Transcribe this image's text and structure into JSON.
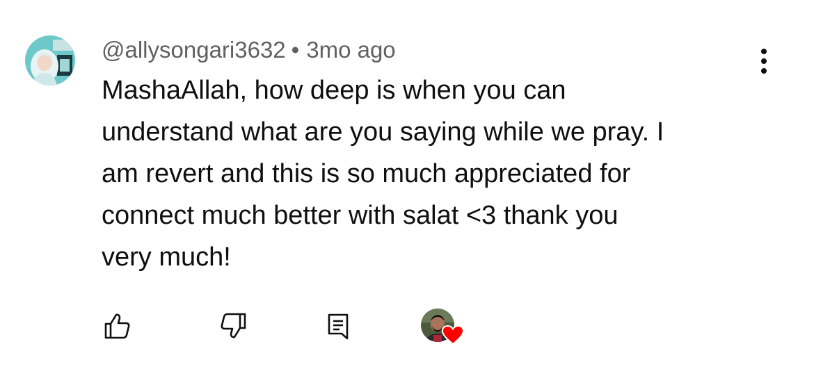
{
  "comment": {
    "author_handle": "@allysongari3632",
    "separator": "•",
    "timestamp": "3mo ago",
    "lines": [
      "MashaAllah, how deep is when you can",
      "understand what are you saying while we pray. I",
      "am revert and this is so much appreciated for",
      "connect much better with salat <3 thank you",
      "very much!"
    ],
    "avatar_icon": "user-avatar-hijab",
    "menu_icon": "more-vertical-icon"
  },
  "actions": {
    "like_icon": "thumbs-up-icon",
    "dislike_icon": "thumbs-down-icon",
    "reply_icon": "comment-icon",
    "creator_heart_icon": "heart-icon"
  },
  "colors": {
    "text_primary": "#0f0f0f",
    "text_secondary": "#606060",
    "heart": "#ff0000",
    "avatar_bg": "#6ec7c9"
  }
}
